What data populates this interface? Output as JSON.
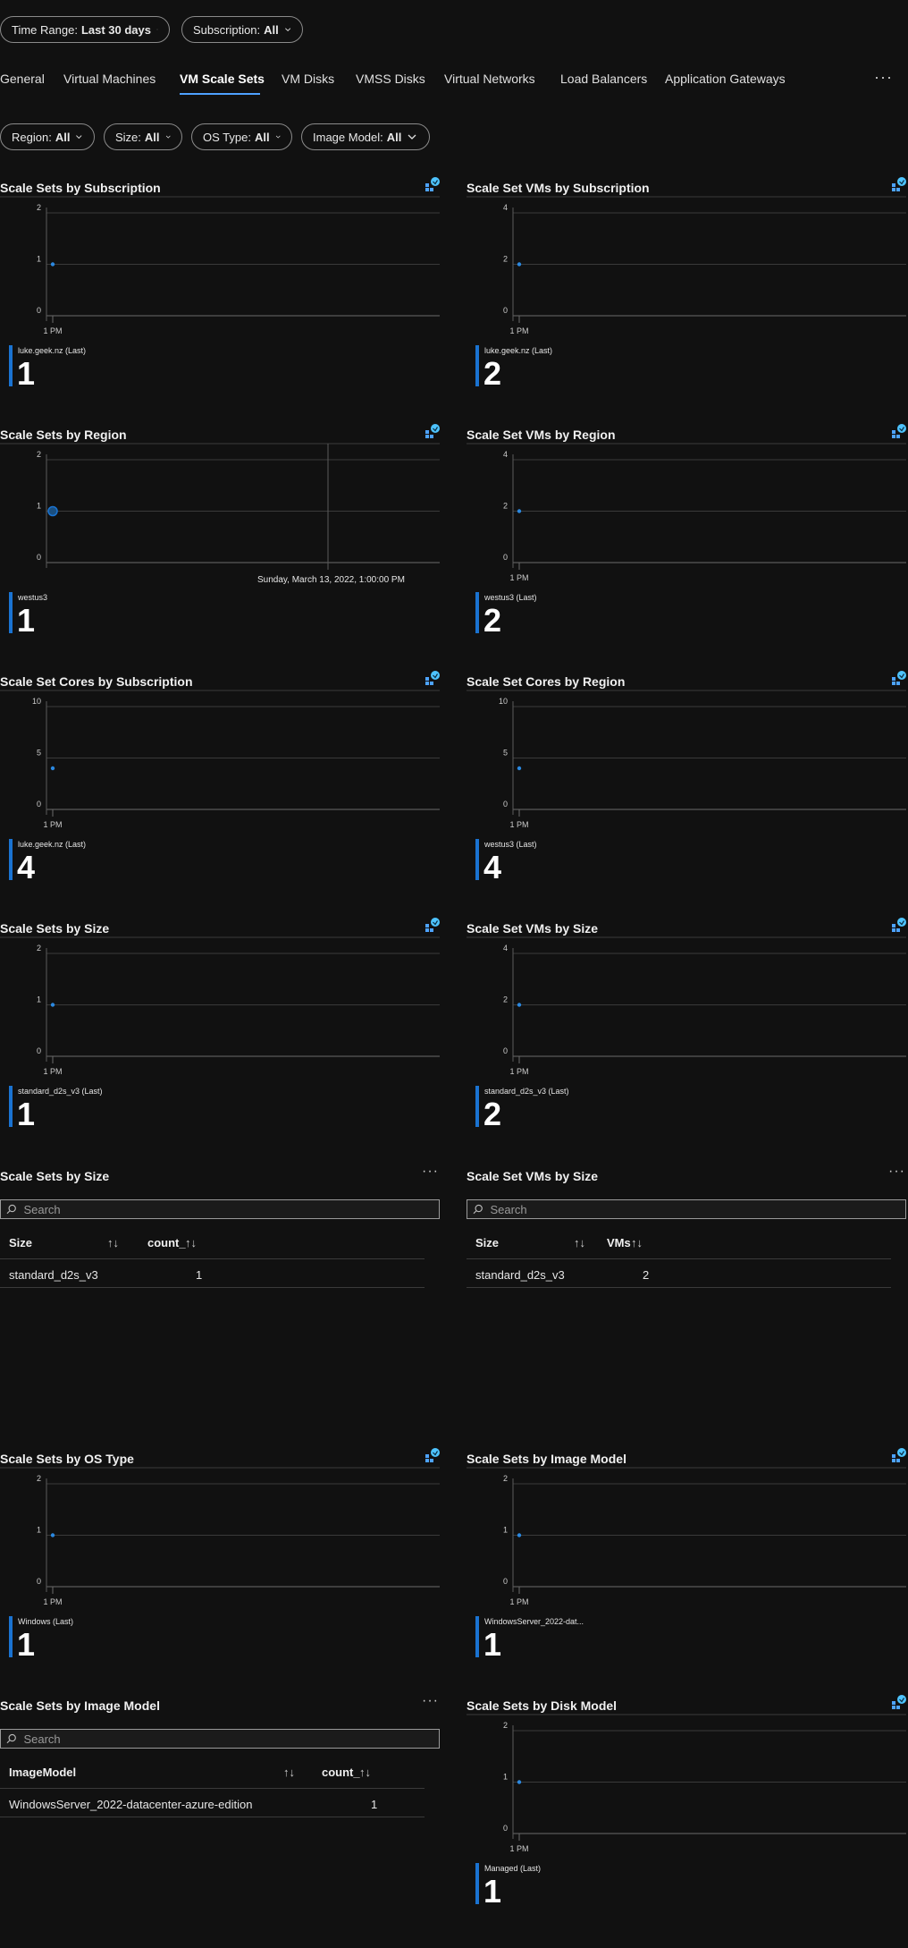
{
  "filters": {
    "time_range": {
      "label": "Time Range:",
      "value": "Last 30 days"
    },
    "subscription": {
      "label": "Subscription:",
      "value": "All"
    },
    "region": {
      "label": "Region:",
      "value": "All"
    },
    "size": {
      "label": "Size:",
      "value": "All"
    },
    "os_type": {
      "label": "OS Type:",
      "value": "All"
    },
    "image_model": {
      "label": "Image Model:",
      "value": "All"
    }
  },
  "tabs": [
    {
      "label": "General"
    },
    {
      "label": "Virtual Machines"
    },
    {
      "label": "VM Scale Sets",
      "active": true
    },
    {
      "label": "VM Disks"
    },
    {
      "label": "VMSS Disks"
    },
    {
      "label": "Virtual Networks"
    },
    {
      "label": "Load Balancers"
    },
    {
      "label": "Application Gateways"
    }
  ],
  "more_label": "···",
  "accent_color": "#1a73d1",
  "charts": [
    {
      "title": "Scale Sets by Subscription",
      "yticks": [
        "2",
        "1",
        "0"
      ],
      "xtick": "1 PM",
      "legend": "luke.geek.nz (Last)",
      "value": "1"
    },
    {
      "title": "Scale Set VMs by Subscription",
      "yticks": [
        "4",
        "2",
        "0"
      ],
      "xtick": "1 PM",
      "legend": "luke.geek.nz (Last)",
      "value": "2"
    },
    {
      "title": "Scale Sets by Region",
      "yticks": [
        "2",
        "1",
        "0"
      ],
      "xtick": "",
      "tooltip": "Sunday, March 13, 2022, 1:00:00 PM",
      "legend": "westus3",
      "value": "1"
    },
    {
      "title": "Scale Set VMs by Region",
      "yticks": [
        "4",
        "2",
        "0"
      ],
      "xtick": "1 PM",
      "legend": "westus3 (Last)",
      "value": "2"
    },
    {
      "title": "Scale Set Cores by Subscription",
      "yticks": [
        "10",
        "5",
        "0"
      ],
      "xtick": "1 PM",
      "legend": "luke.geek.nz (Last)",
      "value": "4"
    },
    {
      "title": "Scale Set Cores by Region",
      "yticks": [
        "10",
        "5",
        "0"
      ],
      "xtick": "1 PM",
      "legend": "westus3 (Last)",
      "value": "4"
    },
    {
      "title": "Scale Sets by Size",
      "yticks": [
        "2",
        "1",
        "0"
      ],
      "xtick": "1 PM",
      "legend": "standard_d2s_v3 (Last)",
      "value": "1"
    },
    {
      "title": "Scale Set VMs by Size",
      "yticks": [
        "4",
        "2",
        "0"
      ],
      "xtick": "1 PM",
      "legend": "standard_d2s_v3 (Last)",
      "value": "2"
    },
    {
      "title": "Scale Sets by OS Type",
      "yticks": [
        "2",
        "1",
        "0"
      ],
      "xtick": "1 PM",
      "legend": "Windows (Last)",
      "value": "1"
    },
    {
      "title": "Scale Sets by Image Model",
      "yticks": [
        "2",
        "1",
        "0"
      ],
      "xtick": "1 PM",
      "legend": "WindowsServer_2022-dat...",
      "value": "1"
    },
    {
      "title": "Scale Sets by Disk Model",
      "yticks": [
        "2",
        "1",
        "0"
      ],
      "xtick": "1 PM",
      "legend": "Managed (Last)",
      "value": "1"
    }
  ],
  "chart_data": [
    {
      "type": "line",
      "title": "Scale Sets by Subscription",
      "x": [
        "1 PM"
      ],
      "series": [
        {
          "name": "luke.geek.nz",
          "values": [
            1
          ]
        }
      ],
      "ylim": [
        0,
        2
      ]
    },
    {
      "type": "line",
      "title": "Scale Set VMs by Subscription",
      "x": [
        "1 PM"
      ],
      "series": [
        {
          "name": "luke.geek.nz",
          "values": [
            2
          ]
        }
      ],
      "ylim": [
        0,
        4
      ]
    },
    {
      "type": "line",
      "title": "Scale Sets by Region",
      "x": [
        "Sunday, March 13, 2022, 1:00:00 PM"
      ],
      "series": [
        {
          "name": "westus3",
          "values": [
            1
          ]
        }
      ],
      "ylim": [
        0,
        2
      ]
    },
    {
      "type": "line",
      "title": "Scale Set VMs by Region",
      "x": [
        "1 PM"
      ],
      "series": [
        {
          "name": "westus3",
          "values": [
            2
          ]
        }
      ],
      "ylim": [
        0,
        4
      ]
    },
    {
      "type": "line",
      "title": "Scale Set Cores by Subscription",
      "x": [
        "1 PM"
      ],
      "series": [
        {
          "name": "luke.geek.nz",
          "values": [
            4
          ]
        }
      ],
      "ylim": [
        0,
        10
      ]
    },
    {
      "type": "line",
      "title": "Scale Set Cores by Region",
      "x": [
        "1 PM"
      ],
      "series": [
        {
          "name": "westus3",
          "values": [
            4
          ]
        }
      ],
      "ylim": [
        0,
        10
      ]
    },
    {
      "type": "line",
      "title": "Scale Sets by Size",
      "x": [
        "1 PM"
      ],
      "series": [
        {
          "name": "standard_d2s_v3",
          "values": [
            1
          ]
        }
      ],
      "ylim": [
        0,
        2
      ]
    },
    {
      "type": "line",
      "title": "Scale Set VMs by Size",
      "x": [
        "1 PM"
      ],
      "series": [
        {
          "name": "standard_d2s_v3",
          "values": [
            2
          ]
        }
      ],
      "ylim": [
        0,
        4
      ]
    },
    {
      "type": "line",
      "title": "Scale Sets by OS Type",
      "x": [
        "1 PM"
      ],
      "series": [
        {
          "name": "Windows",
          "values": [
            1
          ]
        }
      ],
      "ylim": [
        0,
        2
      ]
    },
    {
      "type": "line",
      "title": "Scale Sets by Image Model",
      "x": [
        "1 PM"
      ],
      "series": [
        {
          "name": "WindowsServer_2022-dat...",
          "values": [
            1
          ]
        }
      ],
      "ylim": [
        0,
        2
      ]
    },
    {
      "type": "line",
      "title": "Scale Sets by Disk Model",
      "x": [
        "1 PM"
      ],
      "series": [
        {
          "name": "Managed",
          "values": [
            1
          ]
        }
      ],
      "ylim": [
        0,
        2
      ]
    }
  ],
  "tables": {
    "size_sets": {
      "title": "Scale Sets by Size",
      "search_placeholder": "Search",
      "columns": [
        "Size",
        "count_"
      ],
      "sort_glyph": "↑↓",
      "rows": [
        [
          "standard_d2s_v3",
          "1"
        ]
      ]
    },
    "size_vms": {
      "title": "Scale Set VMs by Size",
      "search_placeholder": "Search",
      "columns": [
        "Size",
        "VMs"
      ],
      "sort_glyph": "↑↓",
      "rows": [
        [
          "standard_d2s_v3",
          "2"
        ]
      ]
    },
    "image_model": {
      "title": "Scale Sets by Image Model",
      "search_placeholder": "Search",
      "columns": [
        "ImageModel",
        "count_"
      ],
      "sort_glyph": "↑↓",
      "rows": [
        [
          "WindowsServer_2022-datacenter-azure-edition",
          "1"
        ]
      ]
    }
  }
}
